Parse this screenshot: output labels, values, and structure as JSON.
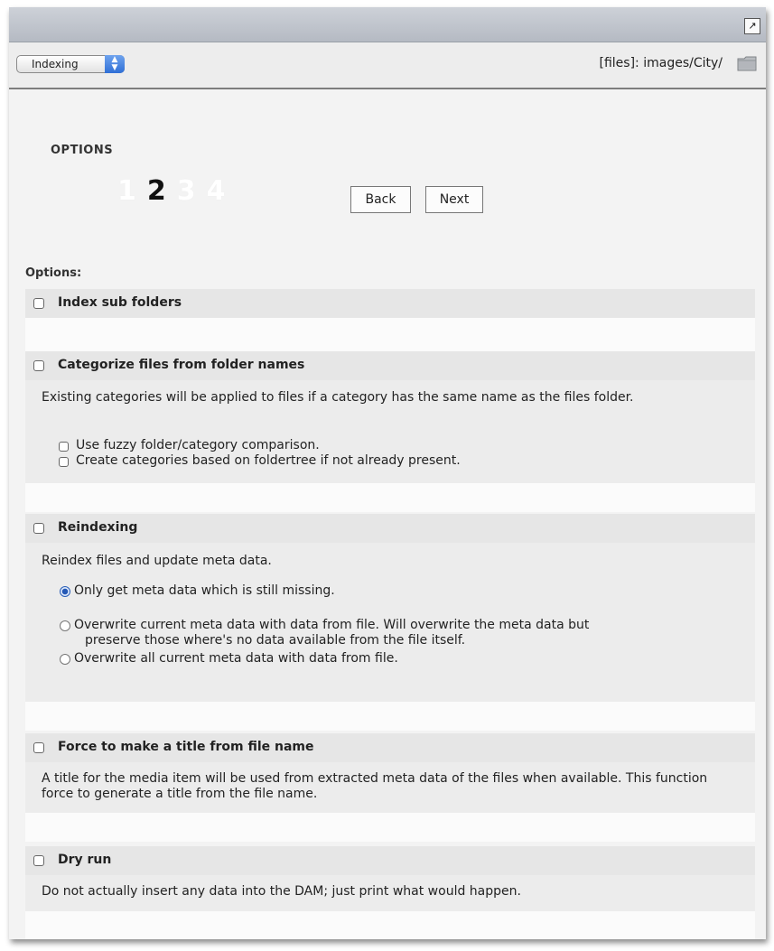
{
  "header": {
    "popout_icon": "popout-icon",
    "module_select": {
      "selected": "Indexing"
    },
    "path_text": "[files]: images/City/",
    "folder_icon": "folder-icon"
  },
  "wizard": {
    "section_title": "OPTIONS",
    "steps": [
      "1",
      "2",
      "3",
      "4"
    ],
    "current_step": 2,
    "back_label": "Back",
    "next_label": "Next"
  },
  "options_label": "Options:",
  "options": {
    "index_sub": {
      "title": "Index sub folders",
      "checked": false
    },
    "categorize": {
      "title": "Categorize files from folder names",
      "desc": "Existing categories will be applied to files if a category has the same name as the files folder.",
      "sub1": "Use fuzzy folder/category comparison.",
      "sub2": "Create categories based on foldertree if not already present."
    },
    "reindex": {
      "title": "Reindexing",
      "desc": "Reindex files and update meta data.",
      "r1": "Only get meta data which is still missing.",
      "r2a": "Overwrite current meta data with data from file. Will overwrite the meta data but",
      "r2b": "preserve those where's no data available from the file itself.",
      "r3": "Overwrite all current meta data with data from file.",
      "selected": 0
    },
    "force_title": {
      "title": "Force to make a title from file name",
      "desc": "A title for the media item will be used from extracted meta data of the files when available. This function force to generate a title from the file name."
    },
    "dry_run": {
      "title": "Dry run",
      "desc": "Do not actually insert any data into the DAM; just print what would happen."
    }
  },
  "colors": {
    "accent": "#2f6fd6",
    "panel_bg": "#f3f3f3",
    "section_head_bg": "#e6e6e6"
  }
}
